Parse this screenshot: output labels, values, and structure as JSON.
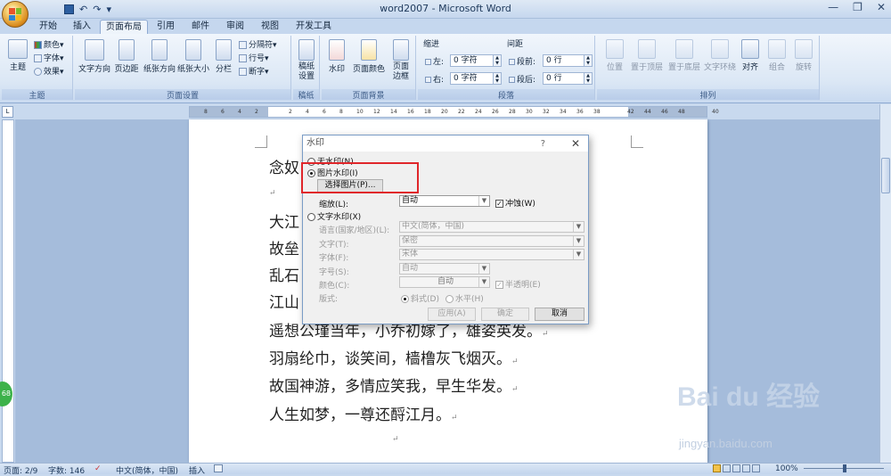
{
  "window": {
    "title": "word2007 - Microsoft Word",
    "minimize": "—",
    "restore": "❐",
    "close": "✕"
  },
  "qat": {
    "undo": "↶",
    "redo": "↷",
    "more": "▾"
  },
  "tabs": [
    "开始",
    "插入",
    "页面布局",
    "引用",
    "邮件",
    "审阅",
    "视图",
    "开发工具"
  ],
  "active_tab": "页面布局",
  "ribbon": {
    "theme": {
      "label": "主题",
      "big": "主题",
      "colors": "颜色",
      "fonts": "字体",
      "effects": "效果"
    },
    "page_setup": {
      "label": "页面设置",
      "text_dir": "文字方向",
      "margins": "页边距",
      "orientation": "纸张方向",
      "size": "纸张大小",
      "columns": "分栏",
      "breaks": "分隔符",
      "line_numbers": "行号",
      "hyphenation": "断字"
    },
    "draft": {
      "label": "稿纸",
      "btn": "稿纸设置"
    },
    "background": {
      "label": "页面背景",
      "watermark": "水印",
      "page_color": "页面颜色",
      "page_border": "页面边框"
    },
    "paragraph": {
      "label": "段落",
      "indent": "缩进",
      "spacing": "间距",
      "left": "左:",
      "right": "右:",
      "before": "段前:",
      "after": "段后:",
      "left_val": "0 字符",
      "right_val": "0 字符",
      "before_val": "0 行",
      "after_val": "0 行"
    },
    "arrange": {
      "label": "排列",
      "position": "位置",
      "bring_front": "置于顶层",
      "send_back": "置于底层",
      "wrap": "文字环绕",
      "align": "对齐",
      "group": "组合",
      "rotate": "旋转"
    }
  },
  "ruler": {
    "ticks": [
      "8",
      "6",
      "4",
      "2",
      "",
      "2",
      "4",
      "6",
      "8",
      "10",
      "12",
      "14",
      "16",
      "18",
      "20",
      "22",
      "24",
      "26",
      "28",
      "30",
      "32",
      "34",
      "36",
      "38",
      "",
      "42",
      "44",
      "46",
      "48",
      "",
      "40"
    ]
  },
  "document": {
    "lines": [
      "念奴",
      "大江",
      "故垒",
      "乱石",
      "江山",
      "遥想公瑾当年，小乔初嫁了，雄姿英发。",
      "羽扇纶巾，谈笑间，樯橹灰飞烟灭。",
      "故国神游，多情应笑我，早生华发。",
      "人生如梦，一尊还酹江月。"
    ],
    "para_mark": "↵"
  },
  "dialog": {
    "title": "水印",
    "help": "?",
    "close": "✕",
    "no_watermark": "无水印(N)",
    "picture_watermark": "图片水印(I)",
    "select_picture": "选择图片(P)...",
    "scale_label": "缩放(L):",
    "scale_value": "自动",
    "washout": "冲蚀(W)",
    "text_watermark": "文字水印(X)",
    "language_label": "语言(国家/地区)(L):",
    "language_value": "中文(简体，中国)",
    "text_label": "文字(T):",
    "text_value": "保密",
    "font_label": "字体(F):",
    "font_value": "宋体",
    "size_label": "字号(S):",
    "size_value": "自动",
    "color_label": "颜色(C):",
    "color_value": "自动",
    "semitransparent": "半透明(E)",
    "layout_label": "版式:",
    "diagonal": "斜式(D)",
    "horizontal": "水平(H)",
    "apply": "应用(A)",
    "ok": "确定",
    "cancel": "取消"
  },
  "status": {
    "page": "页面: 2/9",
    "words": "字数: 146",
    "language": "中文(简体，中国)",
    "insert": "插入",
    "zoom": "100%"
  },
  "watermark": {
    "logo": "Bai du 经验",
    "url": "jingyan.baidu.com"
  },
  "badge": "68",
  "colors": {
    "accent": "#e0262a",
    "ribbon": "#dbe7f5",
    "docbg": "#a5bcdb"
  }
}
